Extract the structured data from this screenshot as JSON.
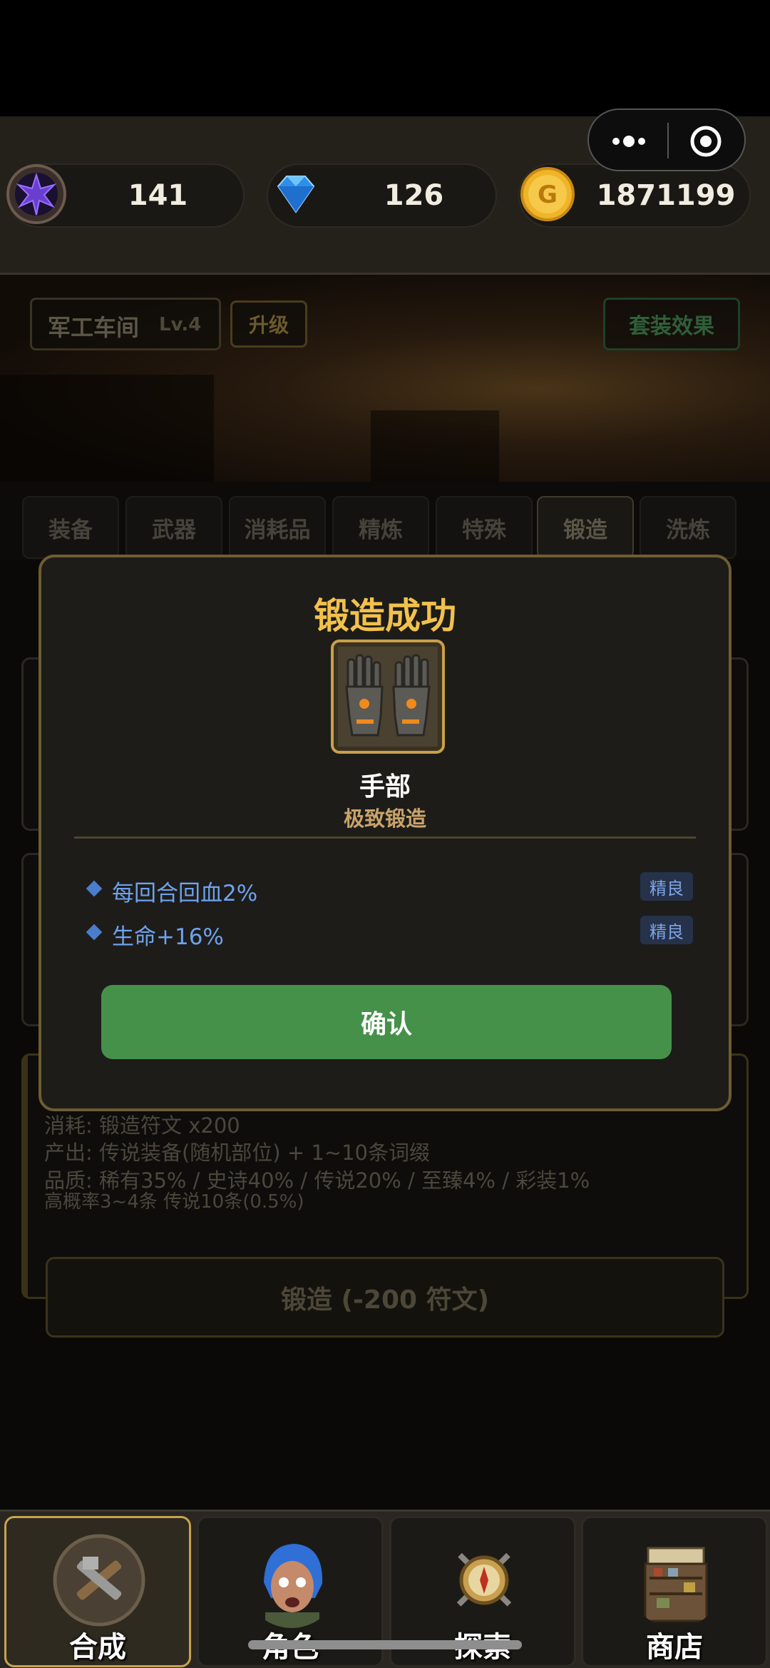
{
  "resources": {
    "rune": {
      "icon": "purple-rune-icon",
      "value": "141"
    },
    "diamond": {
      "icon": "diamond-icon",
      "value": "126"
    },
    "gold": {
      "icon": "gold-coin-icon",
      "value": "1871199"
    }
  },
  "capsule": {
    "more": "more-dots-icon",
    "close": "close-circle-icon"
  },
  "workshop": {
    "title": "军工车间",
    "level": "Lv.4",
    "upgrade_label": "升级",
    "set_effect_label": "套装效果"
  },
  "tabs": [
    {
      "label": "装备"
    },
    {
      "label": "武器"
    },
    {
      "label": "消耗品"
    },
    {
      "label": "精炼"
    },
    {
      "label": "特殊"
    },
    {
      "label": "锻造",
      "active": true
    },
    {
      "label": "洗炼"
    }
  ],
  "forge_info": {
    "cost": "消耗: 锻造符文 x200",
    "output": "产出: 传说装备(随机部位) + 1~10条词缀",
    "quality": "品质: 稀有35% / 史诗40% / 传说20% / 至臻4% / 彩装1%",
    "odds": "高概率3~4条  传说10条(0.5%)"
  },
  "forge_button": "锻造 (-200 符文)",
  "modal": {
    "title": "锻造成功",
    "item_icon": "gauntlets-icon",
    "item_name": "手部",
    "item_subtitle": "极致锻造",
    "affixes": [
      {
        "text": "每回合回血2%",
        "grade": "精良"
      },
      {
        "text": "生命+16%",
        "grade": "精良"
      }
    ],
    "confirm_label": "确认"
  },
  "nav": [
    {
      "label": "合成",
      "icon": "crafting-tools-icon",
      "active": true
    },
    {
      "label": "角色",
      "icon": "character-avatar-icon"
    },
    {
      "label": "探索",
      "icon": "compass-swords-icon"
    },
    {
      "label": "商店",
      "icon": "shop-stall-icon"
    }
  ],
  "colors": {
    "gold_title": "#f2c14d",
    "affix_blue": "#6ea2ee",
    "confirm_green": "#45914a",
    "modal_border": "#6e5c33"
  }
}
